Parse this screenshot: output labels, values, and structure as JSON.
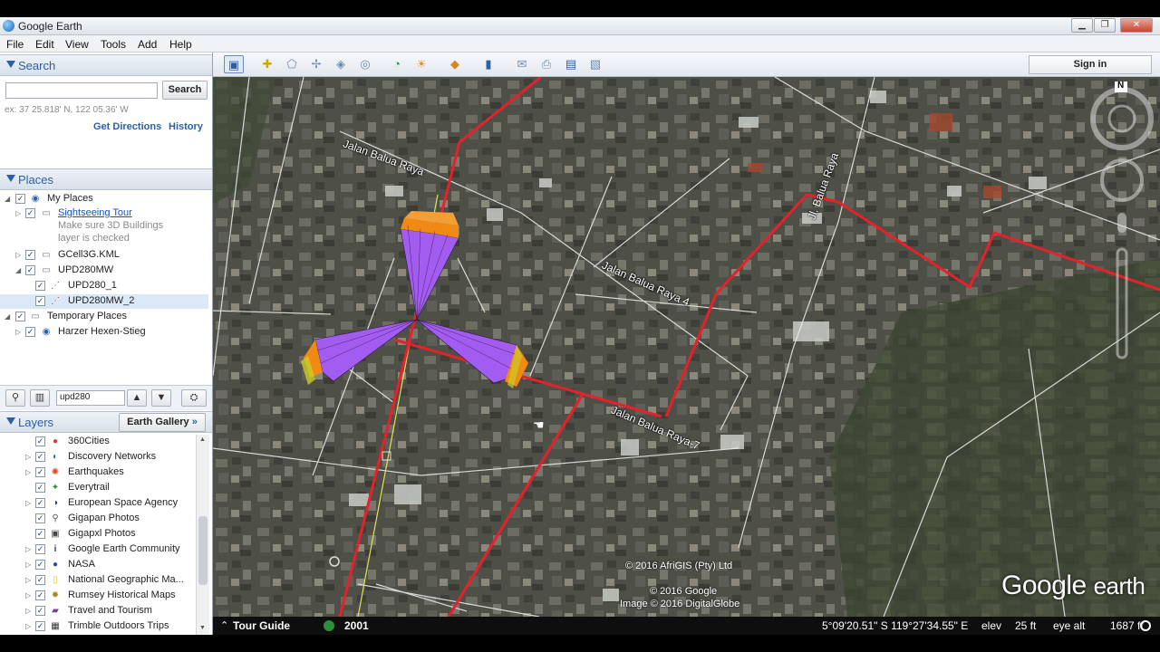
{
  "window": {
    "title": "Google Earth"
  },
  "menu": [
    "File",
    "Edit",
    "View",
    "Tools",
    "Add",
    "Help"
  ],
  "search": {
    "header": "Search",
    "input_value": "",
    "button_label": "Search",
    "hint": "ex: 37 25.818' N, 122 05.36' W",
    "get_directions": "Get Directions",
    "history": "History"
  },
  "places": {
    "header": "Places",
    "items": [
      {
        "label": "My Places",
        "note": ""
      },
      {
        "label": "Sightseeing Tour",
        "note_line1": "Make sure 3D Buildings",
        "note_line2": "layer is checked"
      },
      {
        "label": "GCell3G.KML"
      },
      {
        "label": "UPD280MW"
      },
      {
        "label": "UPD280_1"
      },
      {
        "label": "UPD280MW_2"
      },
      {
        "label": "Temporary Places"
      },
      {
        "label": "Harzer Hexen-Stieg"
      }
    ],
    "filter_value": "upd280"
  },
  "layers": {
    "header": "Layers",
    "gallery_button": "Earth Gallery",
    "gallery_chevron": "»",
    "items": [
      {
        "label": "360Cities"
      },
      {
        "label": "Discovery Networks"
      },
      {
        "label": "Earthquakes"
      },
      {
        "label": "Everytrail"
      },
      {
        "label": "European Space Agency"
      },
      {
        "label": "Gigapan Photos"
      },
      {
        "label": "Gigapxl Photos"
      },
      {
        "label": "Google Earth Community"
      },
      {
        "label": "NASA"
      },
      {
        "label": "National Geographic Ma..."
      },
      {
        "label": "Rumsey Historical Maps"
      },
      {
        "label": "Travel and Tourism"
      },
      {
        "label": "Trimble Outdoors Trips"
      }
    ]
  },
  "toolbar": {
    "signin": "Sign in"
  },
  "map": {
    "road_labels": [
      "Jalan Balua Raya",
      "Jalan Balua Raya 4",
      "Jalan Balua Raya-7",
      "Jl. Balua Raya"
    ],
    "compass_n": "N",
    "copyright1": "© 2016 AfriGIS (Pty) Ltd",
    "copyright2": "© 2016 Google",
    "copyright3": "Image © 2016 DigitalGlobe",
    "logo_word1": "Google",
    "logo_word2": "earth",
    "colors": {
      "route": "#e3222a",
      "sector_inner": "#a35cf0",
      "sector_outer": "#f08a14",
      "sector_tip": "#c9cc27"
    }
  },
  "status": {
    "tour_guide": "Tour Guide",
    "year": "2001",
    "coords": "5°09'20.51\" S  119°27'34.55\" E",
    "elev_label": "elev",
    "elev_value": "25 ft",
    "eye_label": "eye alt",
    "eye_value": "1687 ft"
  }
}
